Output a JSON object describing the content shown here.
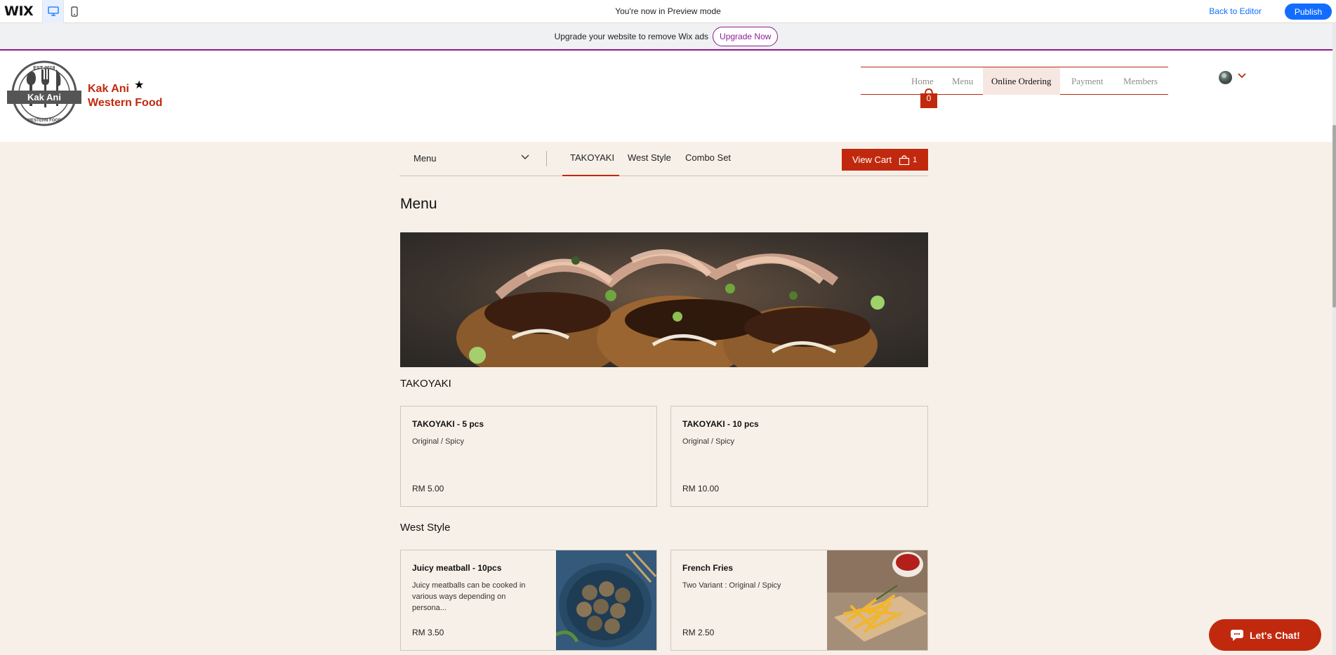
{
  "wix_bar": {
    "logo": "WIX",
    "preview_message": "You're now in Preview mode",
    "back_to_editor": "Back to Editor",
    "publish": "Publish"
  },
  "ad_banner": {
    "message": "Upgrade your website to remove Wix ads",
    "button": "Upgrade Now"
  },
  "site_header": {
    "logo_text": "Kak Ani",
    "logo_ring_text_top": "EST 2018",
    "logo_ring_text_bottom": "WESTERN FOOD",
    "brand_line1": "Kak Ani",
    "brand_line2": "Western Food",
    "brand_star": "★",
    "nav": [
      "Home",
      "Menu",
      "Online Ordering",
      "Payment",
      "Members"
    ],
    "active_nav": "Online Ordering",
    "cart_count": "0"
  },
  "ordering_toolbar": {
    "menu_select": "Menu",
    "tabs": [
      "TAKOYAKI",
      "West Style",
      "Combo Set"
    ],
    "active_tab": "TAKOYAKI",
    "view_cart": "View Cart",
    "cart_qty": "1"
  },
  "menu": {
    "title": "Menu",
    "sections": [
      {
        "title": "TAKOYAKI",
        "items": [
          {
            "name": "TAKOYAKI - 5 pcs",
            "description": "Original / Spicy",
            "price": "RM 5.00"
          },
          {
            "name": "TAKOYAKI - 10 pcs",
            "description": "Original / Spicy",
            "price": "RM 10.00"
          }
        ]
      },
      {
        "title": "West Style",
        "items": [
          {
            "name": "Juicy meatball - 10pcs",
            "description": "Juicy meatballs can be cooked in various ways depending on persona...",
            "price": "RM 3.50"
          },
          {
            "name": "French Fries",
            "description": "Two Variant : Original / Spicy",
            "price": "RM 2.50"
          }
        ]
      }
    ]
  },
  "chat": {
    "label": "Let's Chat!"
  },
  "colors": {
    "brand": "#c1290e",
    "wix_blue": "#116dff",
    "ad_purple": "#8f1f92",
    "page_bg": "#f7f0e8"
  }
}
